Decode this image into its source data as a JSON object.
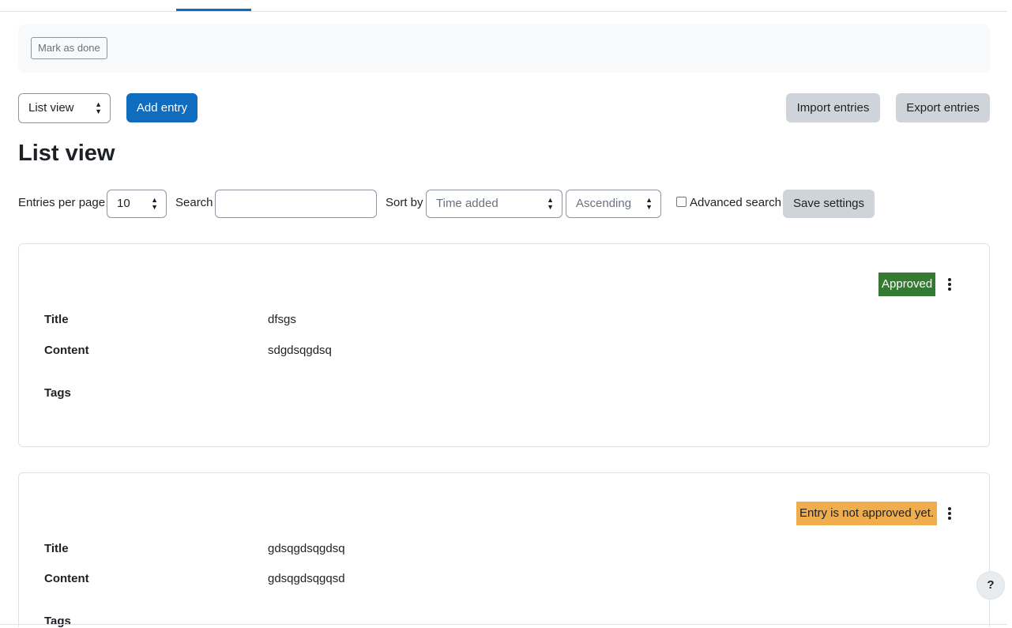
{
  "completion": {
    "mark_done_label": "Mark as done"
  },
  "actions": {
    "view_select_value": "List view",
    "add_entry_label": "Add entry",
    "import_label": "Import entries",
    "export_label": "Export entries"
  },
  "page": {
    "heading": "List view"
  },
  "filters": {
    "entries_per_page_label": "Entries per page",
    "entries_per_page_value": "10",
    "search_label": "Search",
    "search_value": "",
    "sort_by_label": "Sort by",
    "sort_field_value": "Time added",
    "sort_order_value": "Ascending",
    "advanced_search_label": "Advanced search",
    "advanced_search_checked": false,
    "save_settings_label": "Save settings"
  },
  "entries": [
    {
      "status": "Approved",
      "status_color": "#357a32",
      "title_label": "Title",
      "title_value": "dfsgs",
      "content_label": "Content",
      "content_value": "sdgdsqgdsq",
      "tags_label": "Tags"
    },
    {
      "status": "Entry is not approved yet.",
      "status_color": "#f0ad4e",
      "title_label": "Title",
      "title_value": "gdsqgdsqgdsq",
      "content_label": "Content",
      "content_value": "gdsqgdsqgqsd",
      "tags_label": "Tags"
    }
  ],
  "help": {
    "icon": "question-icon",
    "label": "?"
  },
  "colors": {
    "primary": "#0f6cbf",
    "approved": "#357a32",
    "pending": "#f0ad4e",
    "secondary_button": "#ced4da"
  }
}
